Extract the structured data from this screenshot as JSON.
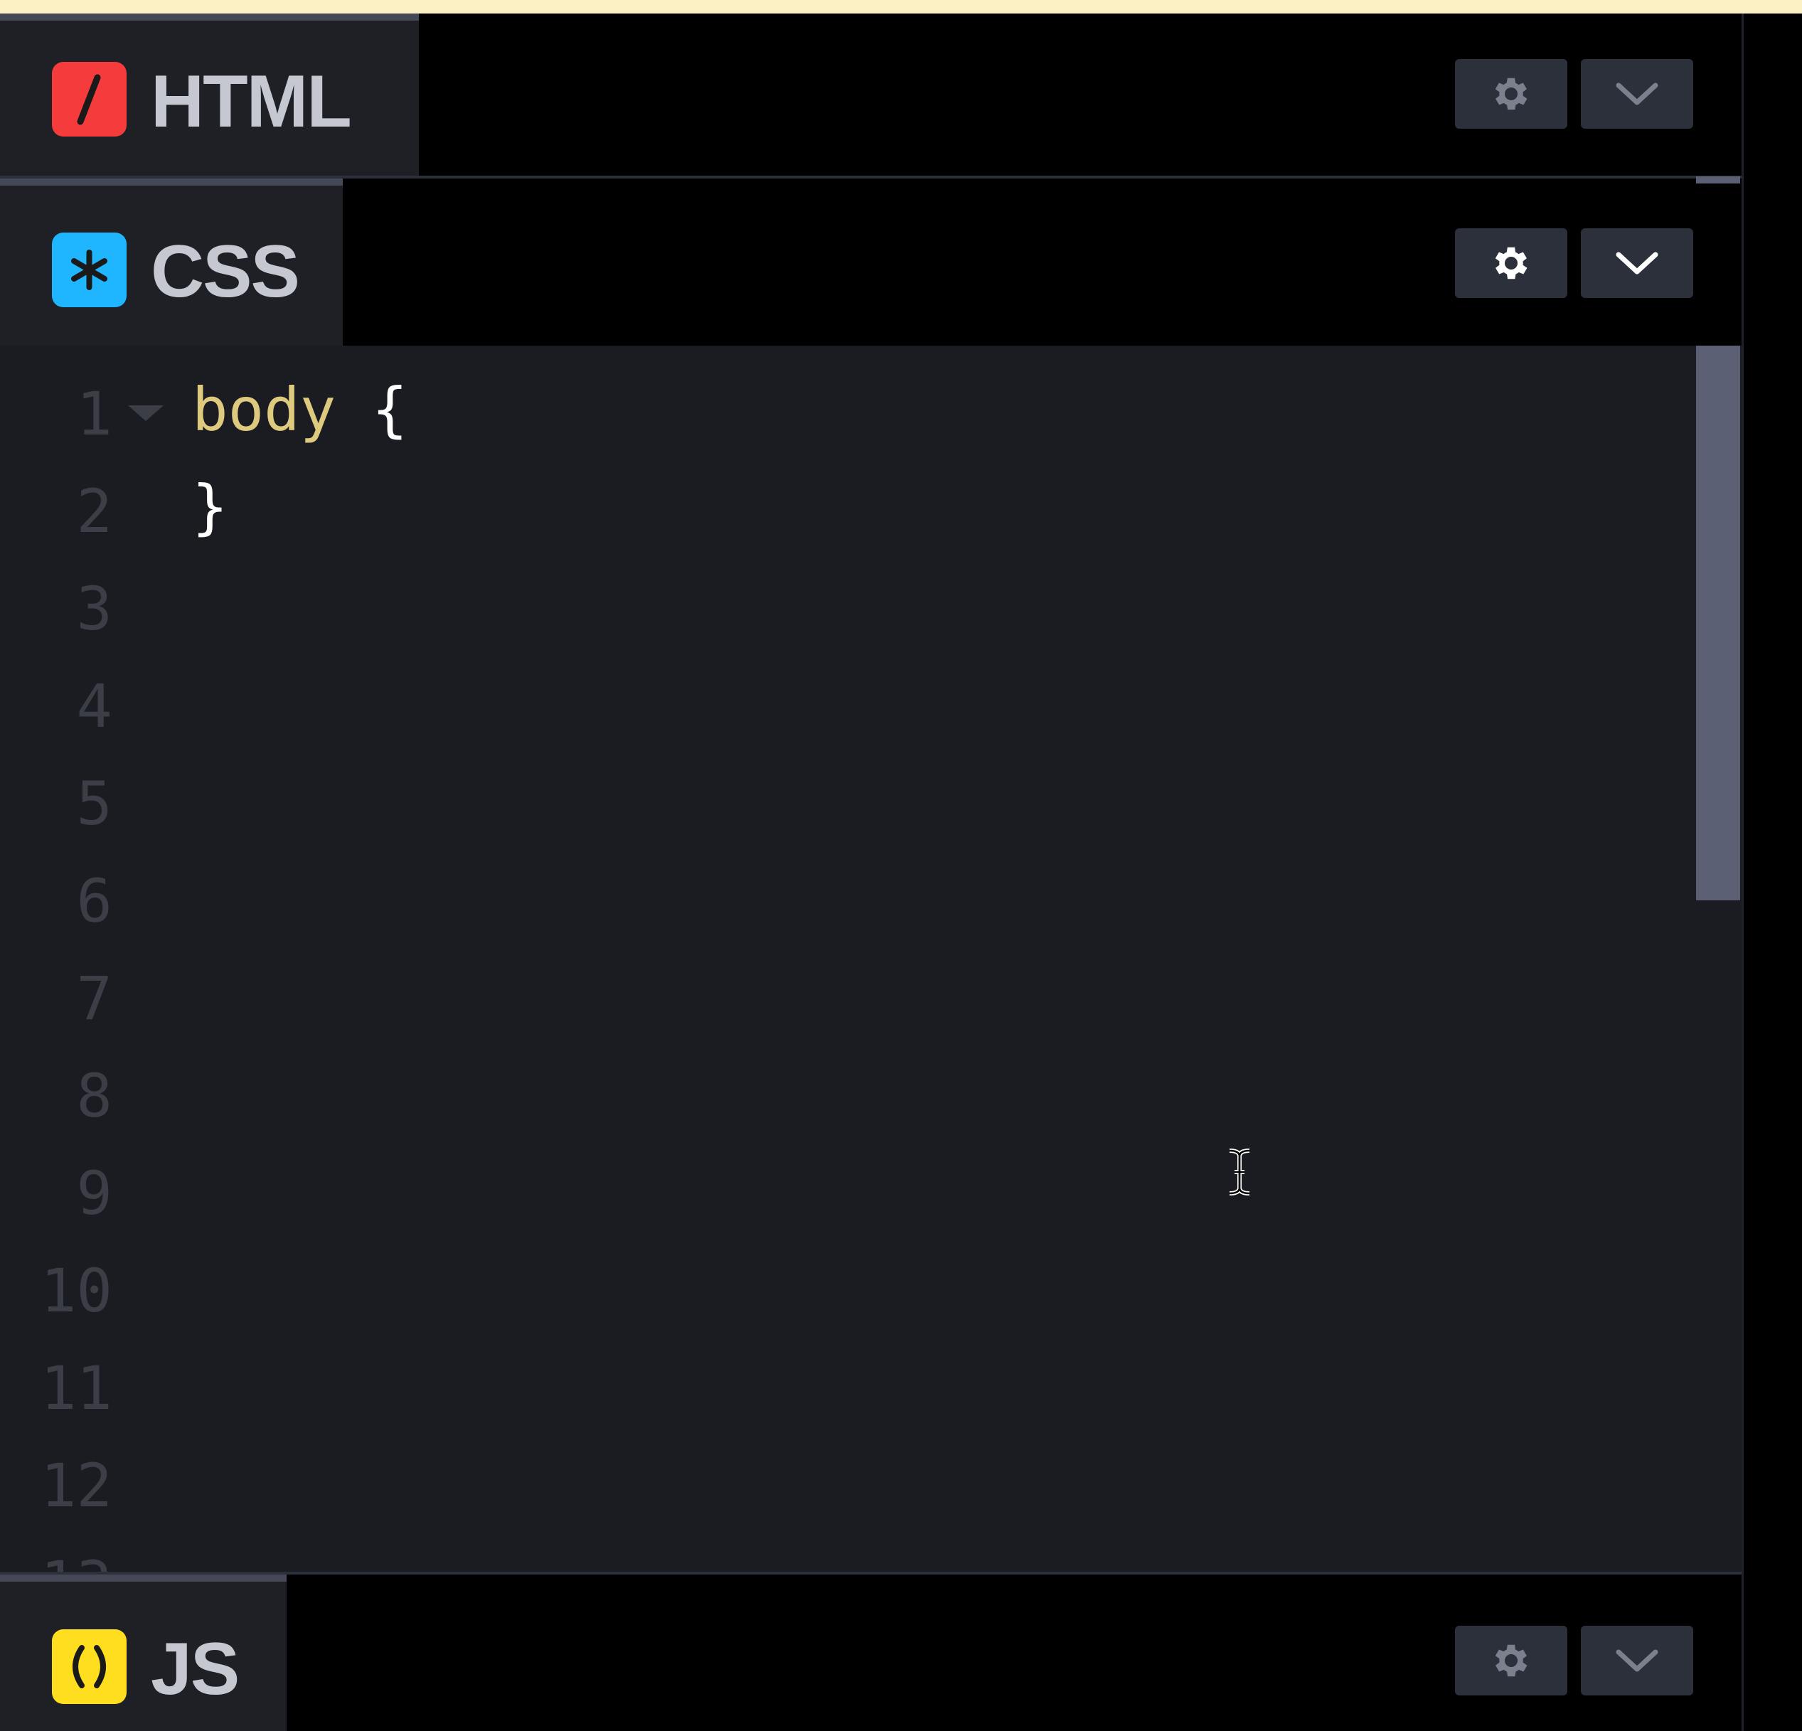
{
  "panels": [
    {
      "id": "html",
      "label": "HTML",
      "icon": "slash-icon",
      "icon_color": "#f53b3b",
      "settings_icon": "gear-icon",
      "collapse_icon": "chevron-down-icon"
    },
    {
      "id": "css",
      "label": "CSS",
      "icon": "asterisk-icon",
      "icon_color": "#1fb6ff",
      "settings_icon": "gear-icon",
      "collapse_icon": "chevron-down-icon"
    },
    {
      "id": "js",
      "label": "JS",
      "icon": "parentheses-icon",
      "icon_color": "#ffdd1f",
      "settings_icon": "gear-icon",
      "collapse_icon": "chevron-down-icon"
    }
  ],
  "editor": {
    "language": "CSS",
    "line_numbers": [
      "1",
      "2",
      "3",
      "4",
      "5",
      "6",
      "7",
      "8",
      "9",
      "10",
      "11",
      "12"
    ],
    "lines": [
      {
        "selector": "body",
        "punct": " {"
      },
      {
        "selector": "",
        "punct": "}"
      }
    ],
    "selector_color": "#ddca7e",
    "punct_color": "#ffffff"
  },
  "colors": {
    "topbar": "#fbf1c4",
    "editor_bg": "#1b1c21",
    "tab_bg": "#1e2026",
    "button_bg": "#2c303a"
  }
}
